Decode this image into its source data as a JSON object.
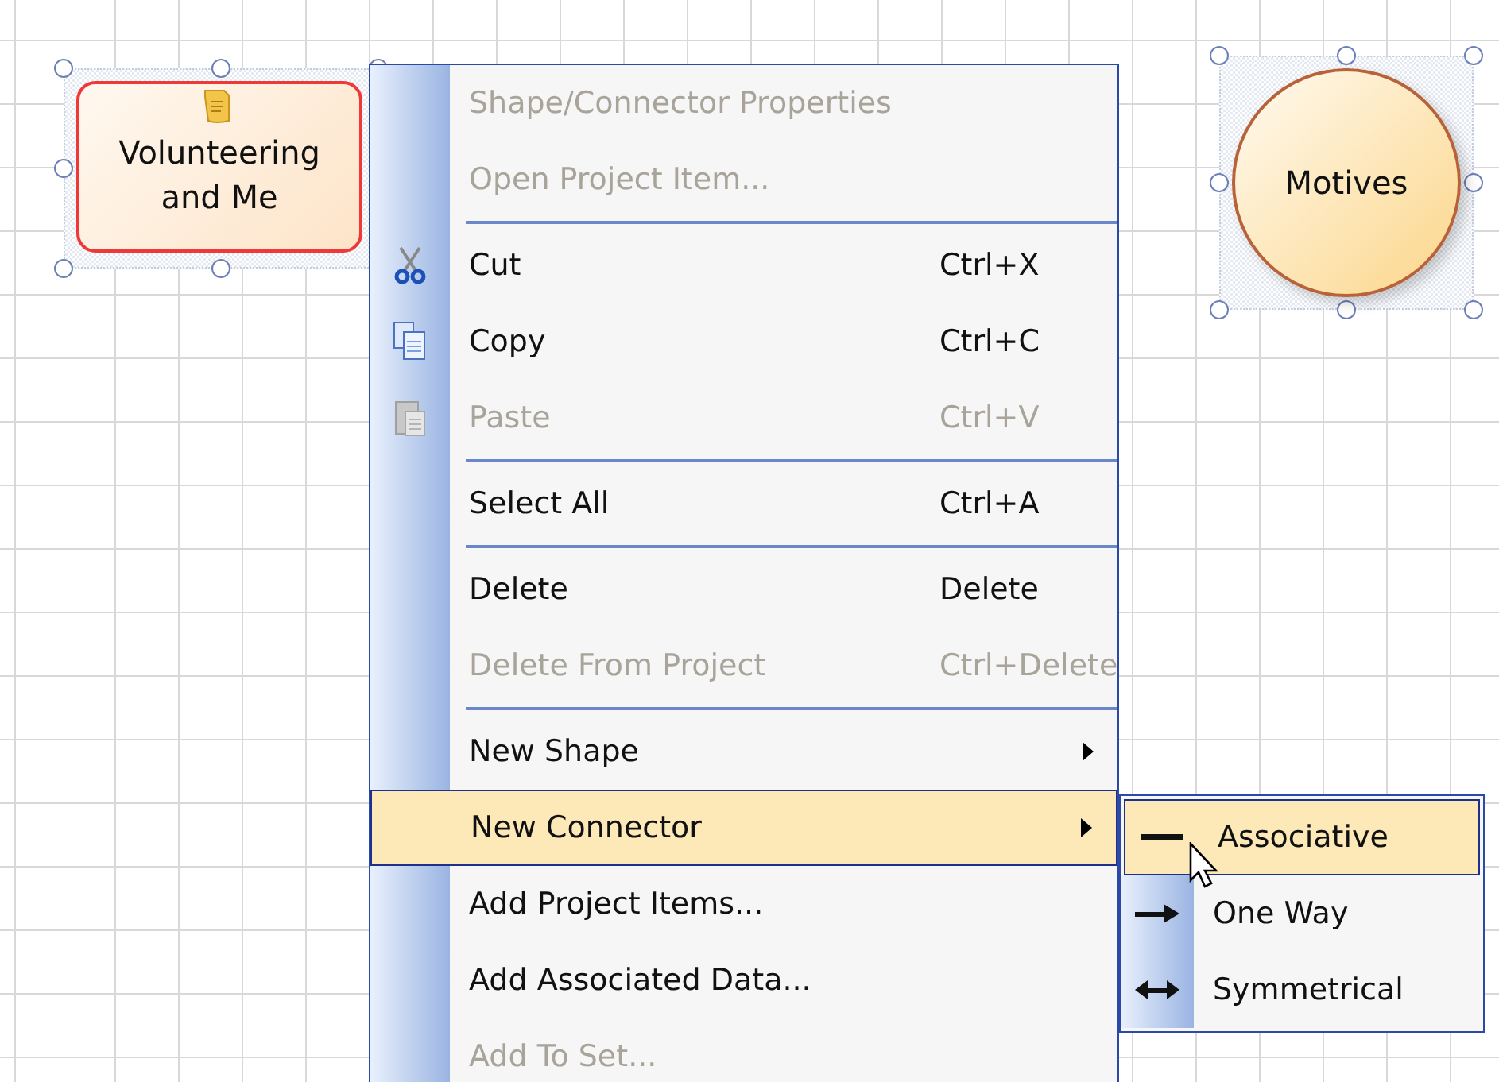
{
  "canvas": {
    "shapes": [
      {
        "kind": "rounded-rect",
        "label": "Volunteering and Me",
        "selected": true,
        "has_note": true
      },
      {
        "kind": "circle",
        "label": "Motives",
        "selected": true,
        "has_note": false
      }
    ]
  },
  "context_menu": {
    "items": [
      {
        "kind": "item",
        "label": "Shape/Connector Properties",
        "disabled": true,
        "selected": false
      },
      {
        "kind": "item",
        "label": "Open Project Item...",
        "disabled": true,
        "selected": false
      },
      {
        "kind": "separator"
      },
      {
        "kind": "item",
        "label": "Cut",
        "shortcut": "Ctrl+X",
        "disabled": false,
        "selected": false
      },
      {
        "kind": "item",
        "label": "Copy",
        "shortcut": "Ctrl+C",
        "disabled": false,
        "selected": false
      },
      {
        "kind": "item",
        "label": "Paste",
        "shortcut": "Ctrl+V",
        "disabled": true,
        "selected": false
      },
      {
        "kind": "separator"
      },
      {
        "kind": "item",
        "label": "Select All",
        "shortcut": "Ctrl+A",
        "disabled": false,
        "selected": false
      },
      {
        "kind": "separator"
      },
      {
        "kind": "item",
        "label": "Delete",
        "shortcut": "Delete",
        "disabled": false,
        "selected": false
      },
      {
        "kind": "item",
        "label": "Delete From Project",
        "shortcut": "Ctrl+Delete",
        "disabled": true,
        "selected": false
      },
      {
        "kind": "separator"
      },
      {
        "kind": "submenu",
        "label": "New Shape",
        "disabled": false,
        "selected": false
      },
      {
        "kind": "submenu",
        "label": "New Connector",
        "disabled": false,
        "selected": true
      },
      {
        "kind": "item",
        "label": "Add Project Items...",
        "disabled": false,
        "selected": false
      },
      {
        "kind": "item",
        "label": "Add Associated Data...",
        "disabled": false,
        "selected": false
      },
      {
        "kind": "item",
        "label": "Add To Set...",
        "disabled": true,
        "selected": false
      }
    ]
  },
  "submenu": {
    "items": [
      {
        "kind": "line",
        "label": "Associative",
        "selected": true
      },
      {
        "kind": "arrow",
        "label": "One Way",
        "selected": false
      },
      {
        "kind": "double-arrow",
        "label": "Symmetrical",
        "selected": false
      }
    ]
  }
}
